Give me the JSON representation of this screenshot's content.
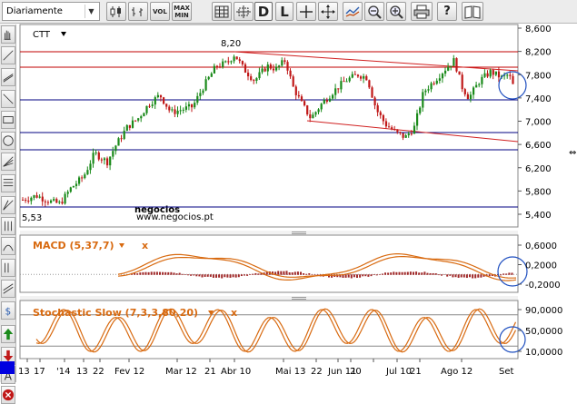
{
  "toolbar": {
    "period_value": "Diariamente",
    "vol_label": "VOL",
    "maxmin_label_top": "MAX",
    "maxmin_label_bottom": "MIN",
    "d_label": "D",
    "l_label": "L",
    "help_label": "?"
  },
  "chart": {
    "symbol": "CTT",
    "high_label": "8,20",
    "low_label": "5,53",
    "watermark": "negocios",
    "watermark_sub": "www.negocios.pt"
  },
  "macd": {
    "title": "MACD (5,37,7)",
    "ticks": [
      "0,6000",
      "0,2000",
      "-0,2000"
    ]
  },
  "stoch": {
    "title": "Stochastic Slow (7,3,3,80,20)",
    "ticks": [
      "90,0000",
      "50,0000",
      "10,0000"
    ]
  },
  "price_ticks": [
    "8,600",
    "8,200",
    "7,800",
    "7,400",
    "7,000",
    "6,600",
    "6,200",
    "5,800",
    "5,400"
  ],
  "x_ticks": [
    "13",
    "17",
    "'14",
    "13",
    "22",
    "Fev 12",
    "Mar 12",
    "21",
    "Abr 10",
    "Mai 13",
    "22",
    "Jun 11",
    "20",
    "Jul 10",
    "21",
    "Ago 12",
    "Set"
  ],
  "colors": {
    "up": "#1a8a1a",
    "down": "#c01818",
    "macd": "#d86a10",
    "support": "#000080",
    "resistance": "#c00000",
    "trend": "#d02020"
  }
}
